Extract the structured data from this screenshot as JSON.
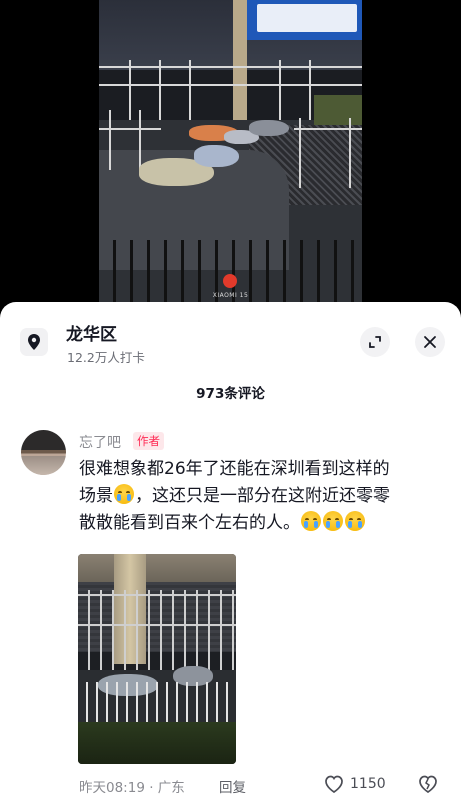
{
  "photo": {
    "watermark": "XIAOMI 15"
  },
  "location": {
    "name": "龙华区",
    "checkins": "12.2万人打卡"
  },
  "comments_header": "973条评论",
  "comment": {
    "username": "忘了吧",
    "author_tag": "作者",
    "text_line1": "很难想象都26年了还能在深圳看到这样的",
    "text_line2a": "场景",
    "text_line2b": "，这还只是一部分在这附近还零零",
    "text_line3": "散散能看到百来个左右的人。",
    "time_location": "昨天08:19 · 广东",
    "reply_label": "回复",
    "like_count": "1150"
  },
  "colors": {
    "author_tag_text": "#fe2c55",
    "author_tag_bg": "#fde7ea",
    "sheet_bg": "#ffffff"
  },
  "icons": [
    "location-pin-icon",
    "expand-icon",
    "close-icon",
    "heart-icon",
    "broken-heart-icon",
    "crying-emoji-icon"
  ]
}
